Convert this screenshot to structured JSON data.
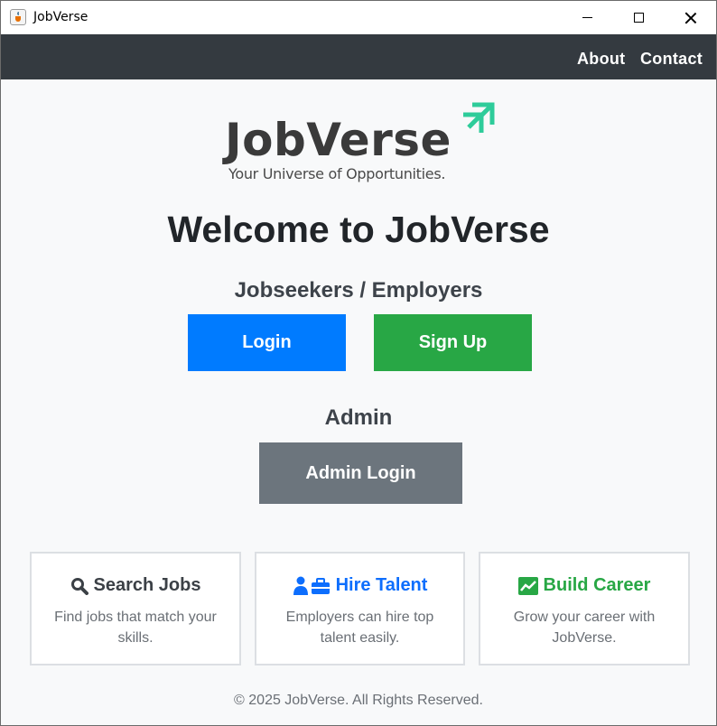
{
  "window": {
    "title": "JobVerse"
  },
  "nav": {
    "about": "About",
    "contact": "Contact"
  },
  "logo": {
    "wordmark": "JobVerse",
    "tagline": "Your Universe of Opportunities."
  },
  "welcome": "Welcome to JobVerse",
  "users_section": {
    "heading": "Jobseekers / Employers",
    "login": "Login",
    "signup": "Sign Up"
  },
  "admin_section": {
    "heading": "Admin",
    "login": "Admin Login"
  },
  "cards": [
    {
      "icon": "magnifier-icon",
      "title": "Search Jobs",
      "desc": "Find jobs that match your skills."
    },
    {
      "icon": "user-briefcase-icon",
      "title": "Hire Talent",
      "desc": "Employers can hire top talent easily."
    },
    {
      "icon": "chart-up-icon",
      "title": "Build Career",
      "desc": "Grow your career with JobVerse."
    }
  ],
  "footer": "© 2025 JobVerse. All Rights Reserved.",
  "colors": {
    "primary": "#007bff",
    "success": "#28a745",
    "secondary": "#6c757d",
    "navbar": "#343a40",
    "logo_accent": "#2ecc9a"
  }
}
